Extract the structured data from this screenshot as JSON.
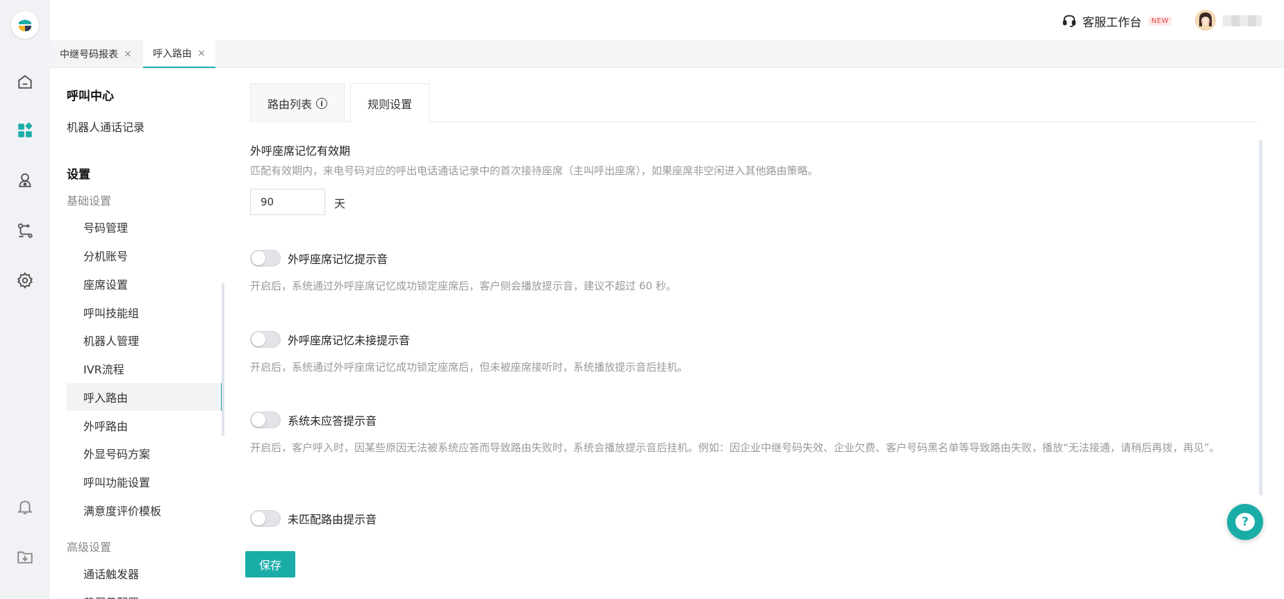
{
  "header": {
    "workbench_label": "客服工作台",
    "workbench_badge": "NEW"
  },
  "page_tabs": [
    {
      "label": "中继号码报表",
      "close": "×"
    },
    {
      "label": "呼入路由",
      "close": "×"
    }
  ],
  "sidebar": {
    "section1_title": "呼叫中心",
    "section1_items": [
      "机器人通话记录"
    ],
    "section2_title": "设置",
    "group_basic": "基础设置",
    "basic_items": [
      "号码管理",
      "分机账号",
      "座席设置",
      "呼叫技能组",
      "机器人管理",
      "IVR流程",
      "呼入路由",
      "外呼路由",
      "外显号码方案",
      "呼叫功能设置",
      "满意度评价模板"
    ],
    "active_item": "呼入路由",
    "group_advanced": "高级设置",
    "advanced_items": [
      "通话触发器",
      "节假日配置"
    ]
  },
  "content_tabs": [
    {
      "label": "路由列表",
      "icon": "info-icon"
    },
    {
      "label": "规则设置"
    }
  ],
  "memory": {
    "label": "外呼座席记忆有效期",
    "desc": "匹配有效期内，来电号码对应的呼出电话通话记录中的首次接待座席（主叫呼出座席），如果座席非空闲进入其他路由策略。",
    "value": "90",
    "unit": "天"
  },
  "toggles": [
    {
      "label": "外呼座席记忆提示音",
      "desc": "开启后，系统通过外呼座席记忆成功锁定座席后，客户侧会播放提示音，建议不超过 60 秒。",
      "on": false
    },
    {
      "label": "外呼座席记忆未接提示音",
      "desc": "开启后，系统通过外呼座席记忆成功锁定座席后，但未被座席接听时，系统播放提示音后挂机。",
      "on": false
    },
    {
      "label": "系统未应答提示音",
      "desc": "开启后，客户呼入时，因某些原因无法被系统应答而导致路由失败时，系统会播放提示音后挂机。例如：因企业中继号码失效、企业欠费、客户号码黑名单等导致路由失败，播放“无法接通，请稍后再拨，再见”。",
      "on": false
    },
    {
      "label": "未匹配路由提示音",
      "on": false
    }
  ],
  "footer": {
    "save_label": "保存"
  },
  "help_fab": {
    "glyph": "?"
  },
  "colors": {
    "accent": "#1aada8",
    "badge_red": "#e5484d"
  }
}
